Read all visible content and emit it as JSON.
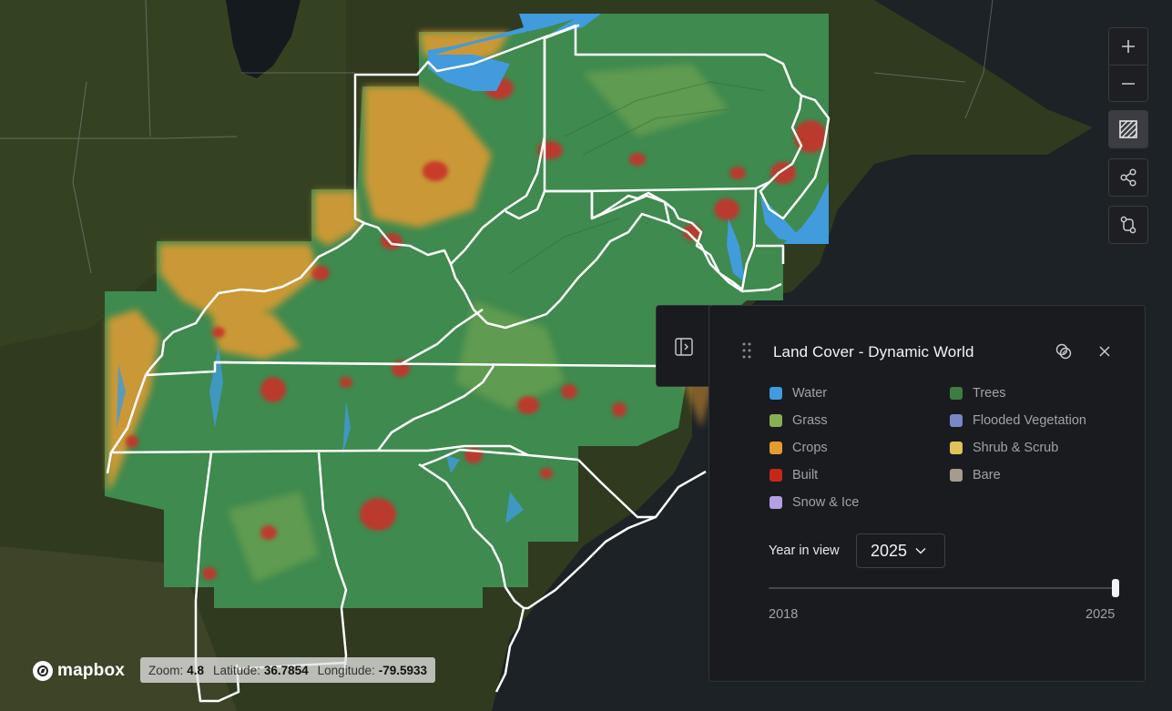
{
  "map": {
    "colors": {
      "ocean": "#1c2226",
      "satellite_land": "#2e3b1c",
      "dataset_base": "#3f8a4f",
      "water": "#419bdc",
      "crops": "#e49b31",
      "built": "#c8312a",
      "boundary": "#ffffff"
    }
  },
  "controls": {
    "zoom_in": "+",
    "zoom_out": "−",
    "icons": [
      "plus-icon",
      "minus-icon",
      "compare-icon",
      "share-icon",
      "workflow-icon"
    ]
  },
  "panel": {
    "title": "Land Cover - Dynamic World",
    "legend": [
      {
        "label": "Water",
        "color": "#419bdc"
      },
      {
        "label": "Trees",
        "color": "#3e7c45"
      },
      {
        "label": "Grass",
        "color": "#88b053"
      },
      {
        "label": "Flooded Vegetation",
        "color": "#7a87c6"
      },
      {
        "label": "Crops",
        "color": "#e49b31"
      },
      {
        "label": "Shrub & Scrub",
        "color": "#dfc35a"
      },
      {
        "label": "Built",
        "color": "#c4281b"
      },
      {
        "label": "Bare",
        "color": "#a59b8f"
      },
      {
        "label": "Snow & Ice",
        "color": "#b39fe1"
      }
    ],
    "year_label": "Year in view",
    "year_value": "2025",
    "slider": {
      "min": "2018",
      "max": "2025",
      "value": 2025
    }
  },
  "footer": {
    "logo_text": "mapbox",
    "zoom_label": "Zoom:",
    "zoom_value": "4.8",
    "lat_label": "Latitude:",
    "lat_value": "36.7854",
    "lon_label": "Longitude:",
    "lon_value": "-79.5933"
  }
}
